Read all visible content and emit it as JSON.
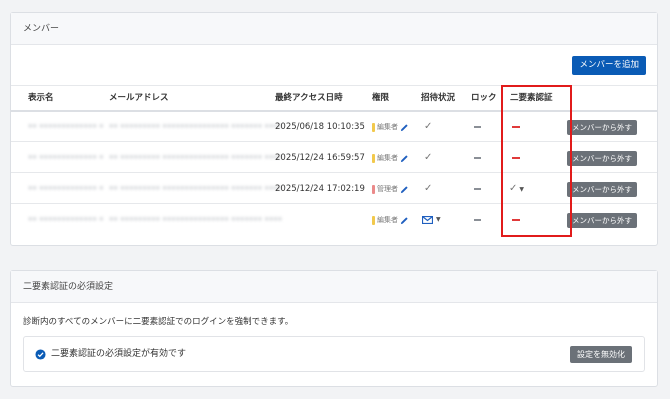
{
  "members": {
    "title": "メンバー",
    "add_button": "メンバーを追加",
    "columns": [
      "表示名",
      "メールアドレス",
      "最終アクセス日時",
      "権限",
      "招待状況",
      "ロック",
      "二要素認証"
    ],
    "rows": [
      {
        "name": "•• ••••••••••••• •",
        "email": "•• ••••••••• ••••••••••••••• ••••••• ••••",
        "last_access": "2025/06/18 10:10:35",
        "role": "編集者",
        "invite": "check",
        "lock": "dash",
        "tfa": "red-dash",
        "remove": "メンバーから外す"
      },
      {
        "name": "•• ••••••••••••• •",
        "email": "•• ••••••••• ••••••••••••••• ••••••• ••••",
        "last_access": "2025/12/24 16:59:57",
        "role": "編集者",
        "invite": "check",
        "lock": "dash",
        "tfa": "red-dash",
        "remove": "メンバーから外す"
      },
      {
        "name": "•• ••••••••••••• •",
        "email": "•• ••••••••• ••••••••••••••• ••••••• ••••",
        "last_access": "2025/12/24 17:02:19",
        "role": "管理者",
        "invite": "check",
        "lock": "dash",
        "tfa": "check-dropdown",
        "remove": "メンバーから外す"
      },
      {
        "name": "•• ••••••••••••• •",
        "email": "•• ••••••••• ••••••••••••••• ••••••• ••••",
        "last_access": "",
        "role": "編集者",
        "invite": "mail-dropdown",
        "lock": "dash",
        "tfa": "red-dash",
        "remove": "メンバーから外す"
      }
    ]
  },
  "tfa": {
    "title": "二要素認証の必須設定",
    "description": "診断内のすべてのメンバーに二要素認証でのログインを強制できます。",
    "status": "二要素認証の必須設定が有効です",
    "disable_button": "設定を無効化"
  },
  "colors": {
    "primary": "#0a5bb5",
    "highlight": "#e11b1b",
    "editor": "#f2c94c",
    "admin": "#eb8a8a",
    "danger": "#e03a3a"
  }
}
